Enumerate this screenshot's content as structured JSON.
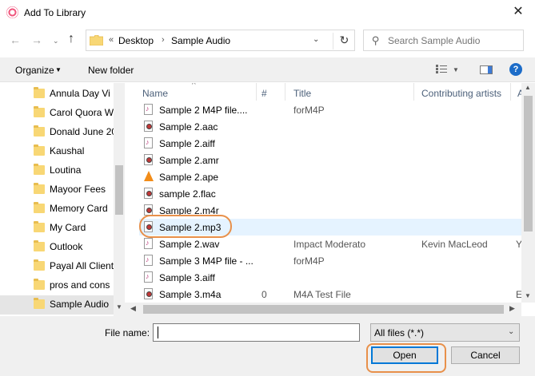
{
  "window": {
    "title": "Add To Library",
    "close_glyph": "✕"
  },
  "nav": {
    "back_glyph": "←",
    "forward_glyph": "→",
    "recent_glyph": "⌄",
    "up_glyph": "↑",
    "breadcrumb_chev": "«",
    "breadcrumb": [
      "Desktop",
      "Sample Audio"
    ],
    "breadcrumb_sep": "›",
    "dropdown_glyph": "⌄",
    "refresh_glyph": "↻",
    "search_placeholder": "Search Sample Audio"
  },
  "toolbar": {
    "organize_label": "Organize",
    "organize_arrow": "▼",
    "new_folder_label": "New folder",
    "view_arrow": "▼",
    "help_label": "?"
  },
  "sidebar": {
    "items": [
      {
        "label": "Annula Day  Vi",
        "selected": false
      },
      {
        "label": "Carol Quora W",
        "selected": false
      },
      {
        "label": "Donald June 20",
        "selected": false
      },
      {
        "label": "Kaushal",
        "selected": false
      },
      {
        "label": "Loutina",
        "selected": false
      },
      {
        "label": "Mayoor Fees",
        "selected": false
      },
      {
        "label": "Memory Card",
        "selected": false
      },
      {
        "label": "My Card",
        "selected": false
      },
      {
        "label": "Outlook",
        "selected": false
      },
      {
        "label": "Payal All Client",
        "selected": false
      },
      {
        "label": "pros and cons",
        "selected": false
      },
      {
        "label": "Sample Audio",
        "selected": true
      }
    ],
    "scroll_down_glyph": "▼"
  },
  "file_list": {
    "sort_glyph": "^",
    "columns": {
      "name": "Name",
      "number": "#",
      "title": "Title",
      "artists": "Contributing artists",
      "extra": "A"
    },
    "rows": [
      {
        "name": "Sample 2 M4P file....",
        "number": "",
        "title": "forM4P",
        "artist": "",
        "extra": "",
        "icon": "note"
      },
      {
        "name": "Sample 2.aac",
        "number": "",
        "title": "",
        "artist": "",
        "extra": "",
        "icon": "media"
      },
      {
        "name": "Sample 2.aiff",
        "number": "",
        "title": "",
        "artist": "",
        "extra": "",
        "icon": "note"
      },
      {
        "name": "Sample 2.amr",
        "number": "",
        "title": "",
        "artist": "",
        "extra": "",
        "icon": "media"
      },
      {
        "name": "Sample 2.ape",
        "number": "",
        "title": "",
        "artist": "",
        "extra": "",
        "icon": "cone"
      },
      {
        "name": "sample 2.flac",
        "number": "",
        "title": "",
        "artist": "",
        "extra": "",
        "icon": "media"
      },
      {
        "name": "Sample 2.m4r",
        "number": "",
        "title": "",
        "artist": "",
        "extra": "",
        "icon": "media"
      },
      {
        "name": "Sample 2.mp3",
        "number": "",
        "title": "",
        "artist": "",
        "extra": "",
        "icon": "media"
      },
      {
        "name": "Sample 2.wav",
        "number": "",
        "title": "Impact Moderato",
        "artist": "Kevin MacLeod",
        "extra": "Y",
        "icon": "note"
      },
      {
        "name": "Sample 3 M4P file - ...",
        "number": "",
        "title": "forM4P",
        "artist": "",
        "extra": "",
        "icon": "note"
      },
      {
        "name": "Sample 3.aiff",
        "number": "",
        "title": "",
        "artist": "",
        "extra": "",
        "icon": "note"
      },
      {
        "name": "Sample 3.m4a",
        "number": "0",
        "title": "M4A Test File",
        "artist": "",
        "extra": "E",
        "icon": "media"
      }
    ],
    "highlighted_row": "Sample 2.mp3",
    "scroll_glyphs": {
      "up": "▲",
      "down": "▼",
      "left": "◀",
      "right": "▶"
    }
  },
  "bottom": {
    "filename_label": "File name:",
    "filename_value": "",
    "filename_arrow": "⌄",
    "filter_value": "All files (*.*)",
    "filter_arrow": "⌄",
    "open_label": "Open",
    "cancel_label": "Cancel"
  },
  "colors": {
    "accent": "#0078d7",
    "highlight_ring": "#e8904a",
    "selected_row": "#e5f3ff",
    "folder": "#f8d775"
  }
}
